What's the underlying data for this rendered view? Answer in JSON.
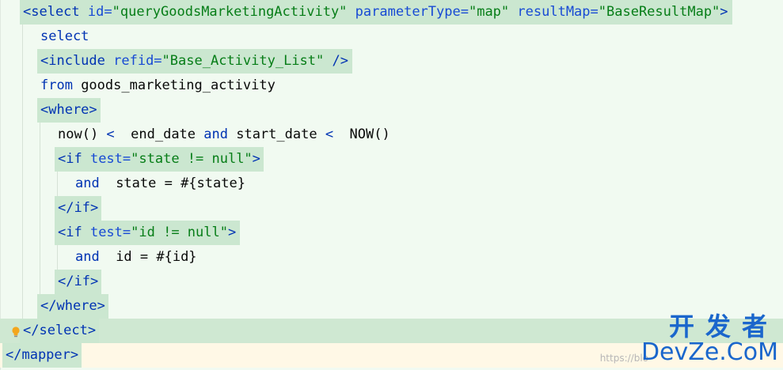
{
  "editor": {
    "lines": [
      {
        "indent": 1,
        "tokens": [
          {
            "t": "<select ",
            "c": "tag"
          },
          {
            "t": "id=",
            "c": "attr"
          },
          {
            "t": "\"queryGoodsMarketingActivity\"",
            "c": "str"
          },
          {
            "t": " ",
            "c": "plain"
          },
          {
            "t": "parameterType=",
            "c": "attr"
          },
          {
            "t": "\"map\"",
            "c": "str"
          },
          {
            "t": " ",
            "c": "plain"
          },
          {
            "t": "resultMap=",
            "c": "attr"
          },
          {
            "t": "\"BaseResultMap\"",
            "c": "str"
          },
          {
            "t": ">",
            "c": "tag"
          }
        ]
      },
      {
        "indent": 2,
        "tokens": [
          {
            "t": "select",
            "c": "kw"
          }
        ]
      },
      {
        "indent": 2,
        "tokens": [
          {
            "t": "<include ",
            "c": "tag"
          },
          {
            "t": "refid=",
            "c": "attr"
          },
          {
            "t": "\"Base_Activity_List\"",
            "c": "str"
          },
          {
            "t": " />",
            "c": "tag"
          }
        ]
      },
      {
        "indent": 2,
        "tokens": [
          {
            "t": "from",
            "c": "kw"
          },
          {
            "t": " goods_marketing_activity",
            "c": "plain"
          }
        ]
      },
      {
        "indent": 2,
        "tokens": [
          {
            "t": "<where>",
            "c": "tag"
          }
        ]
      },
      {
        "indent": 3,
        "tokens": [
          {
            "t": "now() ",
            "c": "plain"
          },
          {
            "t": "&lt;",
            "c": "kw"
          },
          {
            "t": "  end_date ",
            "c": "plain"
          },
          {
            "t": "and",
            "c": "kw"
          },
          {
            "t": " start_date ",
            "c": "plain"
          },
          {
            "t": "&lt;",
            "c": "kw"
          },
          {
            "t": "  NOW()",
            "c": "plain"
          }
        ]
      },
      {
        "indent": 3,
        "tokens": [
          {
            "t": "<if ",
            "c": "tag"
          },
          {
            "t": "test=",
            "c": "attr"
          },
          {
            "t": "\"state != null\"",
            "c": "str"
          },
          {
            "t": ">",
            "c": "tag"
          }
        ]
      },
      {
        "indent": 4,
        "tokens": [
          {
            "t": "and",
            "c": "kw"
          },
          {
            "t": "  state = #{state}",
            "c": "plain"
          }
        ]
      },
      {
        "indent": 3,
        "tokens": [
          {
            "t": "</if>",
            "c": "tag"
          }
        ]
      },
      {
        "indent": 3,
        "tokens": [
          {
            "t": "<if ",
            "c": "tag"
          },
          {
            "t": "test=",
            "c": "attr"
          },
          {
            "t": "\"id != null\"",
            "c": "str"
          },
          {
            "t": ">",
            "c": "tag"
          }
        ]
      },
      {
        "indent": 4,
        "tokens": [
          {
            "t": "and",
            "c": "kw"
          },
          {
            "t": "  id = #{id}",
            "c": "plain"
          }
        ]
      },
      {
        "indent": 3,
        "tokens": [
          {
            "t": "</if>",
            "c": "tag"
          }
        ]
      },
      {
        "indent": 2,
        "tokens": [
          {
            "t": "</where>",
            "c": "tag"
          }
        ]
      },
      {
        "indent": 1,
        "tokens": [
          {
            "t": "</select>",
            "c": "tag"
          }
        ]
      },
      {
        "indent": 0,
        "tokens": [
          {
            "t": "</mapper>",
            "c": "tag"
          }
        ]
      }
    ]
  },
  "watermark": {
    "cn": "开发者",
    "en": "DevZe.CoM",
    "url": "https://blo"
  },
  "colors": {
    "background": "#f1faf1",
    "highlight": "#cbe7d0",
    "tag": "#0033b3",
    "string": "#067d17",
    "watermark": "#1a66cc"
  },
  "icons": {
    "intention": "lightbulb-icon"
  }
}
